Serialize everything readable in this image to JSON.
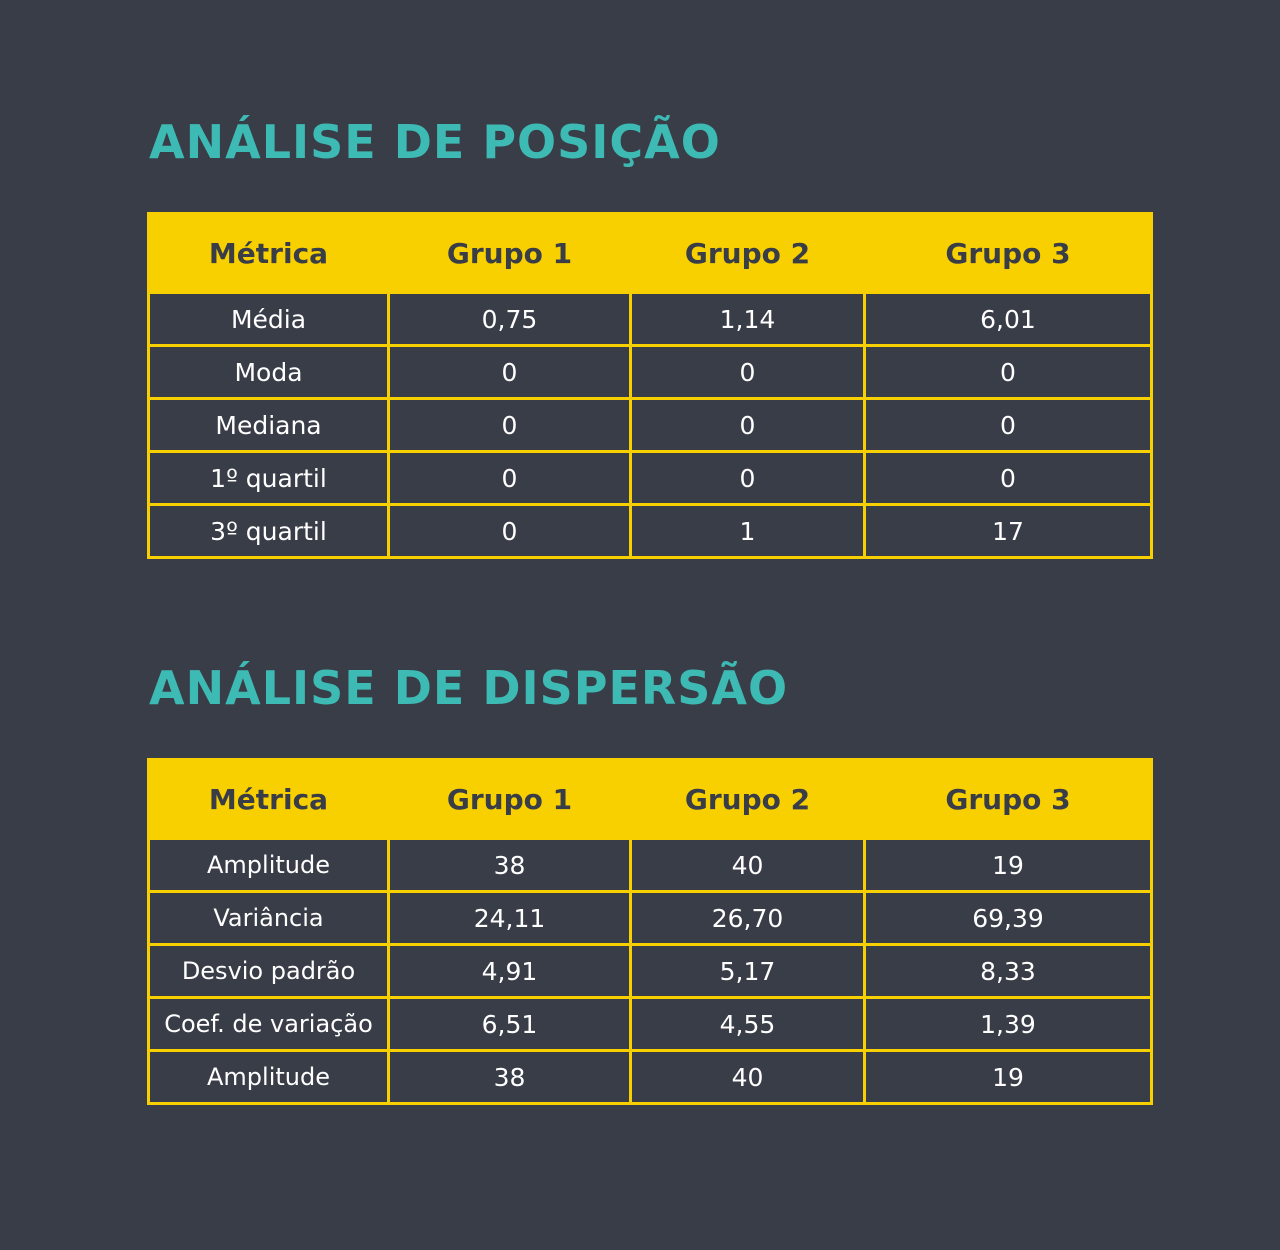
{
  "sections": [
    {
      "title": "ANÁLISE DE POSIÇÃO",
      "headers": [
        "Métrica",
        "Grupo 1",
        "Grupo 2",
        "Grupo 3"
      ],
      "rows": [
        [
          "Média",
          "0,75",
          "1,14",
          "6,01"
        ],
        [
          "Moda",
          "0",
          "0",
          "0"
        ],
        [
          "Mediana",
          "0",
          "0",
          "0"
        ],
        [
          "1º quartil",
          "0",
          "0",
          "0"
        ],
        [
          "3º quartil",
          "0",
          "1",
          "17"
        ]
      ]
    },
    {
      "title": "ANÁLISE DE DISPERSÃO",
      "headers": [
        "Métrica",
        "Grupo 1",
        "Grupo 2",
        "Grupo 3"
      ],
      "rows": [
        [
          "Amplitude",
          "38",
          "40",
          "19"
        ],
        [
          "Variância",
          "24,11",
          "26,70",
          "69,39"
        ],
        [
          "Desvio padrão",
          "4,91",
          "5,17",
          "8,33"
        ],
        [
          "Coef. de variação",
          "6,51",
          "4,55",
          "1,39"
        ],
        [
          "Amplitude",
          "38",
          "40",
          "19"
        ]
      ]
    }
  ],
  "colors": {
    "background": "#393d48",
    "title": "#3ebab4",
    "header_fill": "#f8d000",
    "header_text": "#393d48",
    "border": "#f8d000",
    "cell_text": "#ffffff"
  }
}
